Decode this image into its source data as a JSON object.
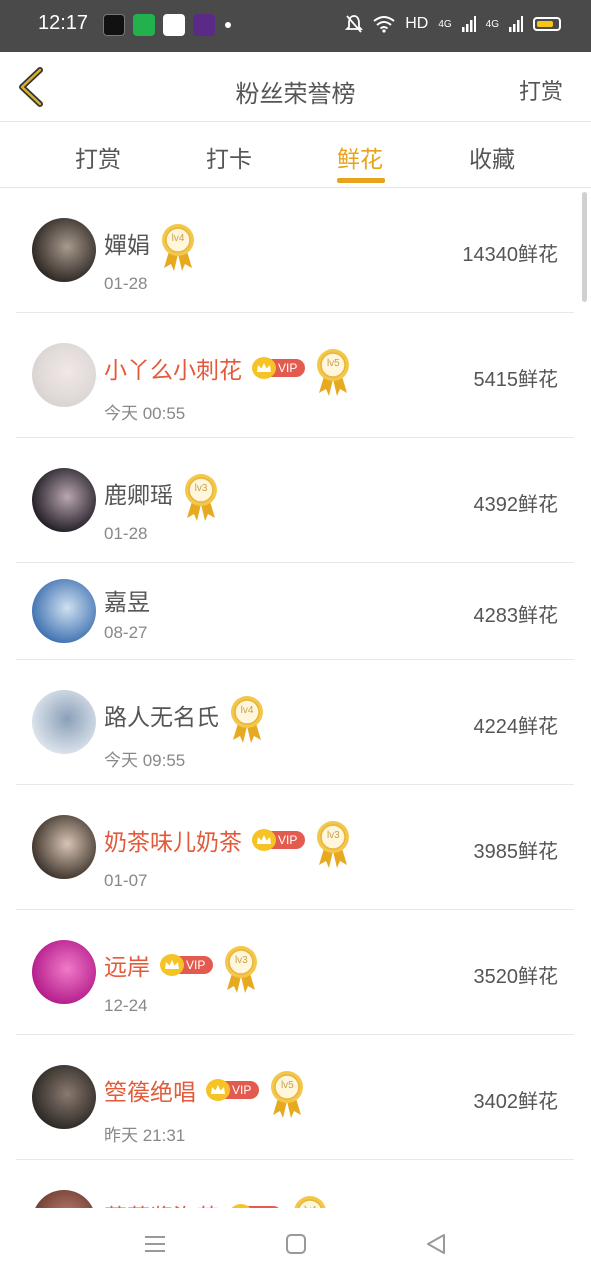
{
  "status_bar": {
    "time": "12:17",
    "network": "HD",
    "signal_1": "4G",
    "signal_2": "4G"
  },
  "header": {
    "title": "粉丝荣誉榜",
    "action_label": "打赏"
  },
  "tabs": [
    {
      "label": "打赏",
      "active": false
    },
    {
      "label": "打卡",
      "active": false
    },
    {
      "label": "鲜花",
      "active": true
    },
    {
      "label": "收藏",
      "active": false
    }
  ],
  "vip_label": "VIP",
  "accent_color": "#e9a21b",
  "vip_name_color": "#e35a3a",
  "fans": [
    {
      "name": "嬋娟",
      "vip": false,
      "level": "lv4",
      "date": "01-28",
      "amount": "14340鲜花"
    },
    {
      "name": "小丫么小刺花",
      "vip": true,
      "level": "lv5",
      "date": "今天 00:55",
      "amount": "5415鲜花"
    },
    {
      "name": "鹿卿瑶",
      "vip": false,
      "level": "lv3",
      "date": "01-28",
      "amount": "4392鲜花"
    },
    {
      "name": "嘉昱",
      "vip": false,
      "level": "",
      "date": "08-27",
      "amount": "4283鲜花"
    },
    {
      "name": "路人无名氏",
      "vip": false,
      "level": "lv4",
      "date": "今天 09:55",
      "amount": "4224鲜花"
    },
    {
      "name": "奶茶味儿奶茶",
      "vip": true,
      "level": "lv3",
      "date": "01-07",
      "amount": "3985鲜花"
    },
    {
      "name": "远岸",
      "vip": true,
      "level": "lv3",
      "date": "12-24",
      "amount": "3520鲜花"
    },
    {
      "name": "箜篌绝唱",
      "vip": true,
      "level": "lv5",
      "date": "昨天 21:31",
      "amount": "3402鲜花"
    },
    {
      "name": "草莓酱泡芙",
      "vip": true,
      "level": "lv4",
      "date": "",
      "amount": ""
    }
  ]
}
